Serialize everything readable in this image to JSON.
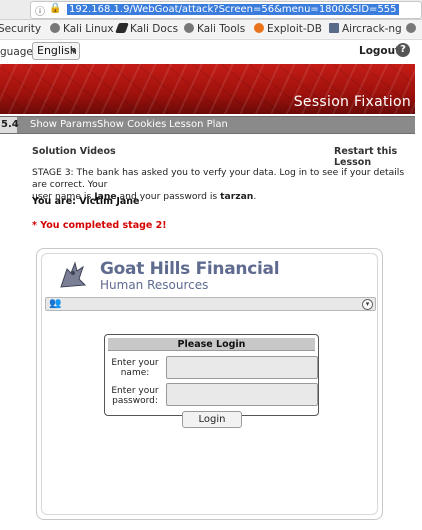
{
  "browser": {
    "url": "192.168.1.9/WebGoat/attack?Screen=56&menu=1800&SID=555",
    "bookmarks": [
      "Security",
      "Kali Linux",
      "Kali Docs",
      "Kali Tools",
      "Exploit-DB",
      "Aircrack-ng"
    ]
  },
  "header": {
    "language_label": "guage:",
    "language_value": "English",
    "logout_label": "Logout",
    "help_label": "?"
  },
  "banner": {
    "title": "Session Fixation"
  },
  "navbar": {
    "version": "5.4",
    "links": [
      "Show Params",
      "Show Cookies",
      "Lesson Plan"
    ]
  },
  "lesson": {
    "solution_videos": "Solution Videos",
    "restart": "Restart this Lesson",
    "stage_text_1": "STAGE 3: The bank has asked you to verfy your data. Log in to see if your details are correct. Your",
    "stage_text_2a": "user name is ",
    "stage_user": "Jane",
    "stage_text_2b": " and your password is ",
    "stage_password": "tarzan",
    "stage_text_2c": ".",
    "you_are": "You are: Victim Jane",
    "completed": "* You completed stage 2!"
  },
  "app": {
    "company": "Goat Hills Financial",
    "subtitle": "Human Resources",
    "login_title": "Please Login",
    "username_label": "Enter your name:",
    "password_label": "Enter your password:",
    "login_button": "Login"
  }
}
